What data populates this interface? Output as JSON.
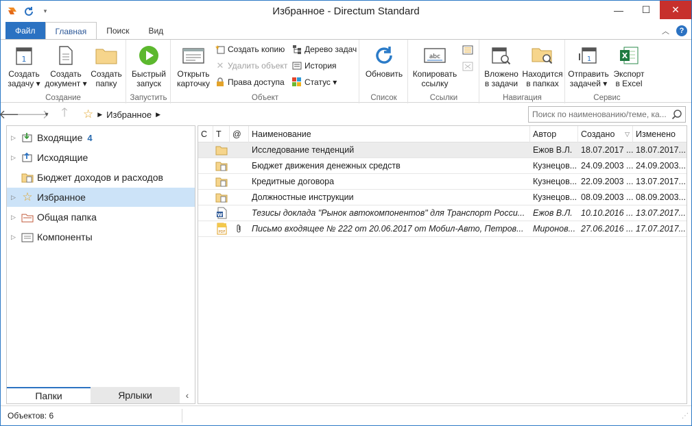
{
  "window": {
    "title": "Избранное - Directum Standard"
  },
  "ribbon_tabs": [
    "Файл",
    "Главная",
    "Поиск",
    "Вид"
  ],
  "ribbon": {
    "groups": {
      "create": "Создание",
      "launch": "Запустить",
      "object": "Объект",
      "list": "Список",
      "links": "Ссылки",
      "navigation": "Навигация",
      "service": "Сервис"
    },
    "create_task": [
      "Создать",
      "задачу ▾"
    ],
    "create_document": [
      "Создать",
      "документ ▾"
    ],
    "create_folder": [
      "Создать",
      "папку"
    ],
    "quick_launch": [
      "Быстрый",
      "запуск"
    ],
    "open_card": [
      "Открыть",
      "карточку"
    ],
    "create_copy": "Создать копию",
    "delete_object": "Удалить объект",
    "access_rights": "Права доступа",
    "task_tree": "Дерево задач",
    "history": "История",
    "status": "Статус ▾",
    "refresh": "Обновить",
    "copy_link": [
      "Копировать",
      "ссылку"
    ],
    "nested_in_tasks": [
      "Вложено",
      "в задачи"
    ],
    "in_folders": [
      "Находится",
      "в папках"
    ],
    "send_tasks": [
      "Отправить",
      "задачей ▾"
    ],
    "export_excel": [
      "Экспорт",
      "в Excel"
    ]
  },
  "navbar": {
    "breadcrumb": "Избранное",
    "search_placeholder": "Поиск по наименованию/теме, ка..."
  },
  "tree": [
    {
      "label": "Входящие",
      "badge": "4",
      "expandable": true,
      "icon": "inbox-icon"
    },
    {
      "label": "Исходящие",
      "badge": "",
      "expandable": true,
      "icon": "outbox-icon"
    },
    {
      "label": "Бюджет доходов и расходов",
      "badge": "",
      "expandable": false,
      "icon": "folder-doc-icon"
    },
    {
      "label": "Избранное",
      "badge": "",
      "expandable": true,
      "icon": "star-icon",
      "selected": true
    },
    {
      "label": "Общая папка",
      "badge": "",
      "expandable": true,
      "icon": "shared-folder-icon"
    },
    {
      "label": "Компоненты",
      "badge": "",
      "expandable": true,
      "icon": "components-icon"
    }
  ],
  "pane_tabs": [
    "Папки",
    "Ярлыки"
  ],
  "grid": {
    "columns": [
      "С",
      "Т",
      "@",
      "Наименование",
      "Автор",
      "Создано",
      "Изменено"
    ],
    "rows": [
      {
        "icon": "folder-icon",
        "attach": "",
        "name": "Исследование тенденций",
        "author": "Ежов В.Л.",
        "created": "18.07.2017 ...",
        "modified": "18.07.2017...",
        "italic": false,
        "selected": true
      },
      {
        "icon": "folder-doc-icon",
        "attach": "",
        "name": "Бюджет движения денежных средств",
        "author": "Кузнецов...",
        "created": "24.09.2003 ...",
        "modified": "24.09.2003...",
        "italic": false
      },
      {
        "icon": "folder-doc-icon",
        "attach": "",
        "name": "Кредитные договора",
        "author": "Кузнецов...",
        "created": "22.09.2003 ...",
        "modified": "13.07.2017...",
        "italic": false
      },
      {
        "icon": "folder-doc-icon",
        "attach": "",
        "name": "Должностные инструкции",
        "author": "Кузнецов...",
        "created": "08.09.2003 ...",
        "modified": "08.09.2003...",
        "italic": false
      },
      {
        "icon": "word-doc-icon",
        "attach": "",
        "name": "Тезисы доклада \"Рынок автокомпонентов\" для Транспорт Росси...",
        "author": "Ежов В.Л.",
        "created": "10.10.2016 ...",
        "modified": "13.07.2017...",
        "italic": true
      },
      {
        "icon": "pdf-doc-icon",
        "attach": "paperclip",
        "name": "Письмо входящее № 222 от 20.06.2017 от Мобил-Авто, Петров...",
        "author": "Миронов...",
        "created": "27.06.2016 ...",
        "modified": "17.07.2017...",
        "italic": true
      }
    ]
  },
  "status": {
    "objects": "Объектов: 6"
  },
  "colors": {
    "accent": "#2b72c2",
    "selection": "#cce3f8",
    "close": "#c7302c"
  }
}
